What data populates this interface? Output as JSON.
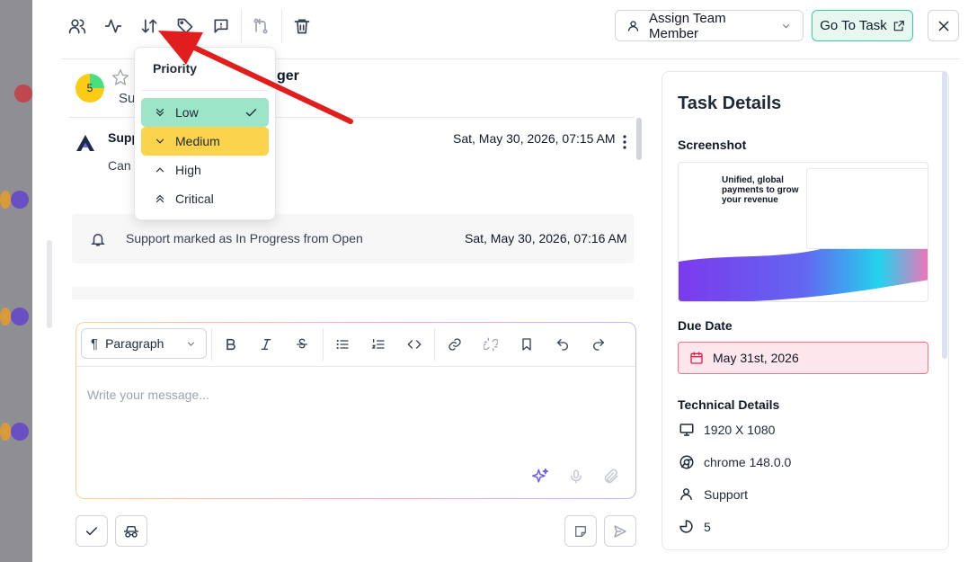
{
  "toolbar": {
    "icons": [
      "users-icon",
      "activity-icon",
      "sort-priority-icon",
      "tag-icon",
      "flag-message-icon",
      "merge-icon",
      "trash-icon"
    ],
    "assign_label": "Assign Team Member",
    "goto_label": "Go To Task"
  },
  "header": {
    "priority_count": "5",
    "title_fragment": "ger",
    "subtitle_fragment": "Su"
  },
  "priority_menu": {
    "title": "Priority",
    "options": [
      {
        "label": "Low",
        "icon": "chevrons-down-icon",
        "selected": true,
        "color": "#9de5c8"
      },
      {
        "label": "Medium",
        "icon": "chevron-down-icon",
        "selected": false,
        "color": "#fcd34d"
      },
      {
        "label": "High",
        "icon": "chevron-up-icon",
        "selected": false
      },
      {
        "label": "Critical",
        "icon": "chevrons-up-icon",
        "selected": false
      }
    ]
  },
  "message": {
    "author_fragment": "Supp",
    "text_fragment": "Can",
    "timestamp": "Sat, May 30, 2026, 07:15 AM"
  },
  "event": {
    "text": "Support marked as In Progress from Open",
    "timestamp": "Sat, May 30, 2026, 07:16 AM"
  },
  "editor": {
    "block_type": "Paragraph",
    "placeholder": "Write your message..."
  },
  "details": {
    "title": "Task Details",
    "screenshot_label": "Screenshot",
    "screenshot_heading": "Unified, global payments to grow your revenue",
    "due_label": "Due Date",
    "due_value": "May 31st, 2026",
    "tech_label": "Technical Details",
    "resolution": "1920 X 1080",
    "browser": "chrome 148.0.0",
    "user": "Support",
    "priority_value": "5"
  },
  "colors": {
    "accent_green": "#34d399",
    "low": "#9de5c8",
    "medium": "#fcd34d",
    "due_border": "#f87185",
    "arrow": "#e11d1d"
  }
}
